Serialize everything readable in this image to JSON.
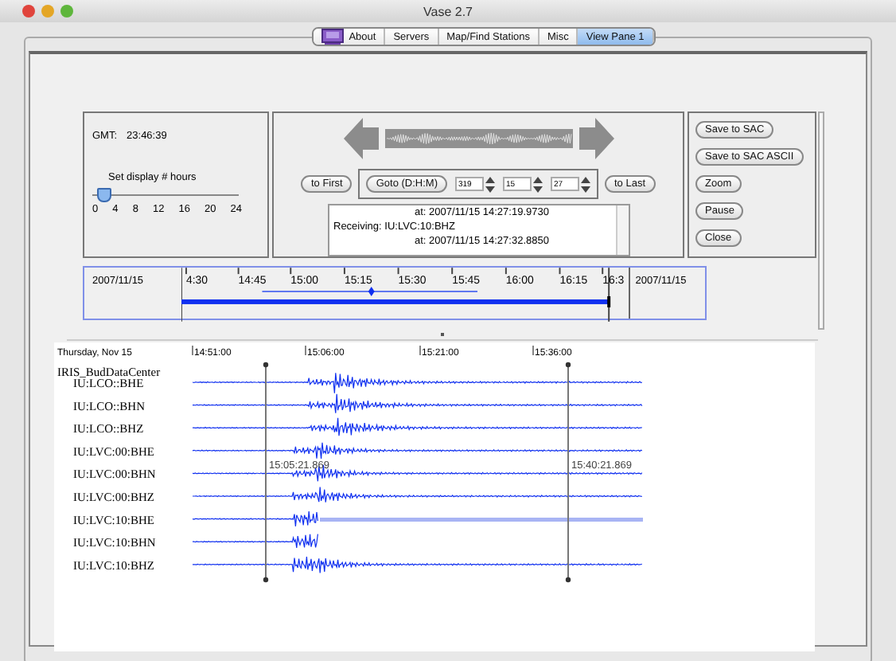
{
  "window": {
    "title": "Vase 2.7"
  },
  "tabs": [
    {
      "label": "About",
      "selected": false,
      "kind": "icon"
    },
    {
      "label": "Servers",
      "selected": false,
      "kind": "plain"
    },
    {
      "label": "Map/Find Stations",
      "selected": false,
      "kind": "plain"
    },
    {
      "label": "Misc",
      "selected": false,
      "kind": "plain"
    },
    {
      "label": "View Pane 1",
      "selected": true,
      "kind": "plain"
    }
  ],
  "clock": {
    "label": "GMT:",
    "value": "23:46:39"
  },
  "hours_slider": {
    "label": "Set display # hours",
    "level": 0.04,
    "ticks": [
      "0",
      "4",
      "8",
      "12",
      "16",
      "20",
      "24"
    ]
  },
  "navigation": {
    "first_button": "to First",
    "goto_button": "Goto (D:H:M)",
    "spinners": [
      "319",
      "15",
      "27"
    ],
    "last_button": "to Last"
  },
  "log": [
    "at: 2007/11/15 14:27:19.9730",
    "Receiving: IU:LVC:10:BHZ",
    "at: 2007/11/15 14:27:32.8850"
  ],
  "actions": [
    "Save to SAC",
    "Save to SAC ASCII",
    "Zoom",
    "Pause",
    "Close"
  ],
  "timeline": {
    "start_date": "2007/11/15",
    "ticks": [
      "4:30",
      "14:45",
      "15:00",
      "15:15",
      "15:30",
      "15:45",
      "16:00",
      "16:15",
      "16:3"
    ],
    "end_date": "2007/11/15"
  },
  "seismograms": {
    "day": "Thursday, Nov 15",
    "time_ticks": [
      "14:51:00",
      "15:06:00",
      "15:21:00",
      "15:36:00"
    ],
    "data_center": "IRIS_BudDataCenter",
    "channels": [
      "IU:LCO::BHE",
      "IU:LCO::BHN",
      "IU:LCO::BHZ",
      "IU:LVC:00:BHE",
      "IU:LVC:00:BHN",
      "IU:LVC:00:BHZ",
      "IU:LVC:10:BHE",
      "IU:LVC:10:BHN",
      "IU:LVC:10:BHZ"
    ],
    "markers": [
      "15:05:21.869",
      "15:40:21.869"
    ]
  }
}
